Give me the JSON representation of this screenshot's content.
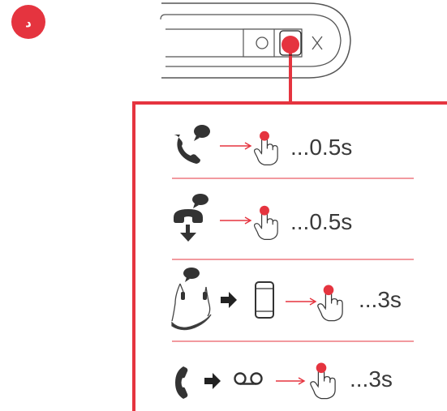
{
  "step_badge": "د",
  "rows": [
    {
      "id": "answer-call",
      "duration": "...0.5s"
    },
    {
      "id": "end-call",
      "duration": "...0.5s"
    },
    {
      "id": "transfer-call",
      "duration": "...3s"
    },
    {
      "id": "voicemail",
      "duration": "...3s"
    }
  ],
  "colors": {
    "accent": "#e5343f",
    "icon": "#333333",
    "outline": "#555555",
    "text": "#3a3a3a"
  }
}
